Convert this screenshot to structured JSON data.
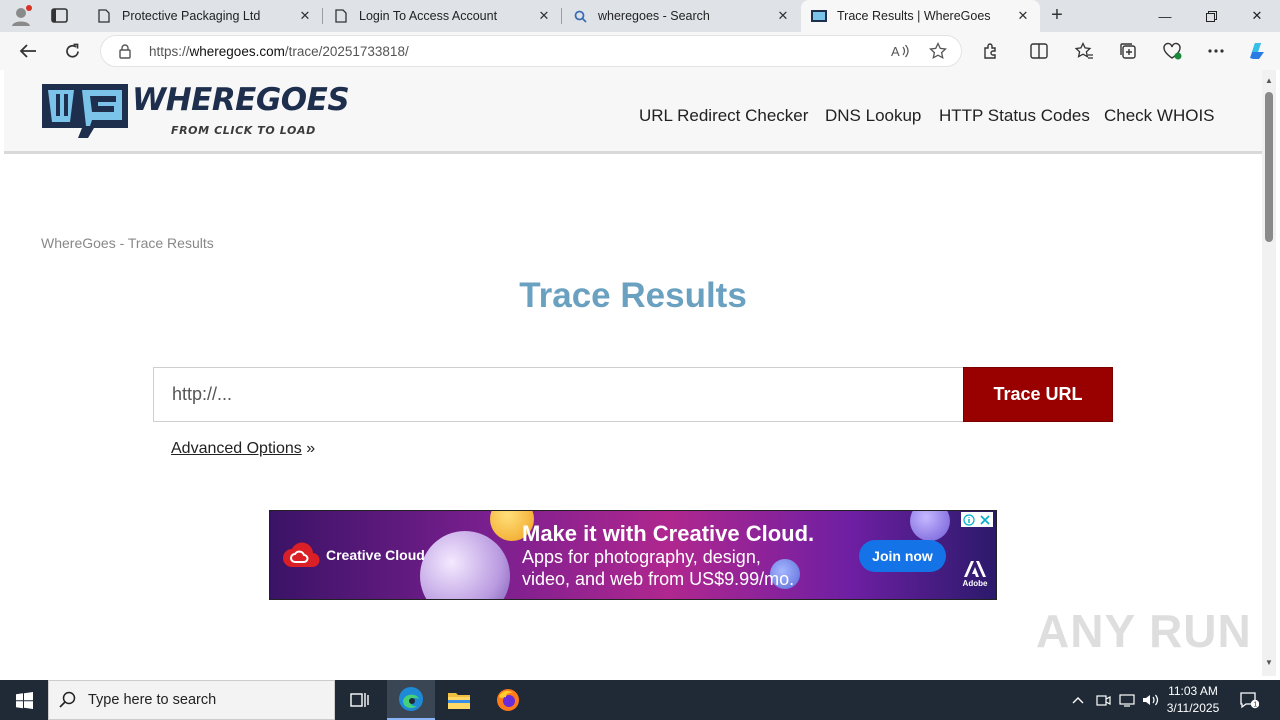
{
  "browser": {
    "tabs": [
      {
        "title": "Protective Packaging Ltd",
        "active": false
      },
      {
        "title": "Login To Access Account",
        "active": false
      },
      {
        "title": "wheregoes - Search",
        "active": false
      },
      {
        "title": "Trace Results | WhereGoes",
        "active": true
      }
    ],
    "address": {
      "prefix": "https://",
      "domain": "wheregoes.com",
      "path": "/trace/20251733818/"
    }
  },
  "site": {
    "logo_text": "WHEREGOES",
    "tagline": "FROM CLICK TO LOAD",
    "nav": [
      "URL Redirect Checker",
      "DNS Lookup",
      "HTTP Status Codes",
      "Check WHOIS"
    ],
    "breadcrumb": "WhereGoes - Trace Results",
    "title": "Trace Results",
    "input_placeholder": "http://...",
    "trace_button": "Trace URL",
    "advanced_link": "Advanced Options",
    "advanced_suffix": " »"
  },
  "ad": {
    "brand": "Creative Cloud",
    "headline": "Make it with Creative Cloud.",
    "line1": "Apps for photography, design,",
    "line2": "video, and web from US$9.99/mo.",
    "cta": "Join now",
    "adobe": "Adobe"
  },
  "watermark": "ANY RUN",
  "taskbar": {
    "search_placeholder": "Type here to search",
    "time": "11:03 AM",
    "date": "3/11/2025",
    "notification_count": "1"
  },
  "colors": {
    "title_blue": "#6aa1c0",
    "button_red": "#990000",
    "logo_navy": "#1e2f4d"
  }
}
